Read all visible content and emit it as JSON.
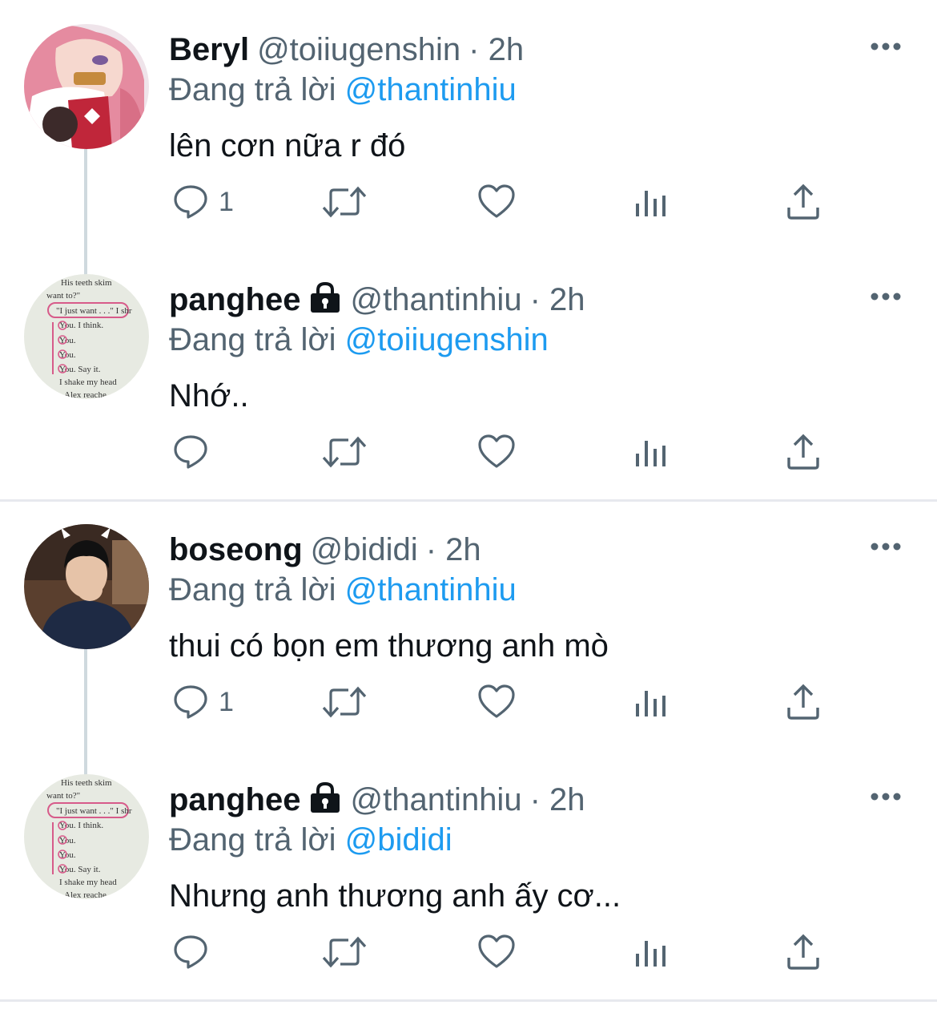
{
  "reply_prefix": "Đang trả lời",
  "tweets": [
    {
      "name": "Beryl",
      "handle": "@toiiugenshin",
      "time": "· 2h",
      "reply_to": "@thantinhiu",
      "text": "lên cơn nữa r đó",
      "reply_count": "1",
      "locked": false,
      "avatar": "anime-girl-avatar"
    },
    {
      "name": "panghee",
      "handle": "@thantinhiu",
      "time": "· 2h",
      "reply_to": "@toiiugenshin",
      "text": "Nhớ..",
      "reply_count": "",
      "locked": true,
      "avatar": "book-page-avatar",
      "avatar_text": [
        "His teeth skim",
        "want to?\"",
        "\"I just want . . .\" I shr",
        "You. I think.",
        "You.",
        "You.",
        "You. Say it.",
        "I shake my head",
        "Alex reache"
      ]
    },
    {
      "name": "boseong",
      "handle": "@bididi",
      "time": "· 2h",
      "reply_to": "@thantinhiu",
      "text": "thui có bọn em thương anh mò",
      "reply_count": "1",
      "locked": false,
      "avatar": "person-hoodie-avatar"
    },
    {
      "name": "panghee",
      "handle": "@thantinhiu",
      "time": "· 2h",
      "reply_to": "@bididi",
      "text": "Nhưng anh thương anh ấy cơ...",
      "reply_count": "",
      "locked": true,
      "avatar": "book-page-avatar",
      "avatar_text": [
        "His teeth skim",
        "want to?\"",
        "\"I just want . . .\" I shr",
        "You. I think.",
        "You.",
        "You.",
        "You. Say it.",
        "I shake my head",
        "Alex reache"
      ]
    }
  ],
  "colors": {
    "text": "#0f1419",
    "secondary": "#536471",
    "link": "#1d9bf0",
    "thread_line": "#cfd9de",
    "divider": "#e7e9ee"
  },
  "icons": [
    "reply-icon",
    "retweet-icon",
    "like-icon",
    "views-icon",
    "share-icon",
    "more-icon",
    "lock-icon"
  ]
}
